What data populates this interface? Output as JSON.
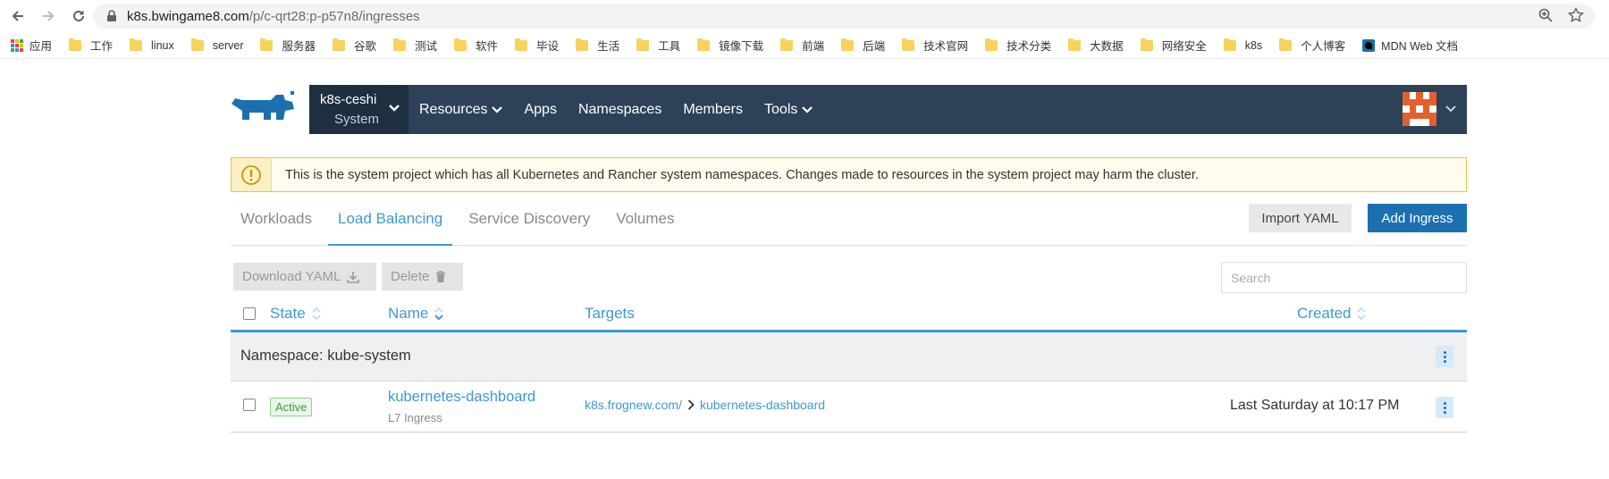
{
  "browser": {
    "url_host": "k8s.bwingame8.com",
    "url_path": "/p/c-qrt28:p-p57n8/ingresses"
  },
  "bookmarks": [
    {
      "label": "应用",
      "icon": "apps-grid-icon"
    },
    {
      "label": "工作",
      "icon": "folder-icon"
    },
    {
      "label": "linux",
      "icon": "folder-icon"
    },
    {
      "label": "server",
      "icon": "folder-icon"
    },
    {
      "label": "服务器",
      "icon": "folder-icon"
    },
    {
      "label": "谷歌",
      "icon": "folder-icon"
    },
    {
      "label": "测试",
      "icon": "folder-icon"
    },
    {
      "label": "软件",
      "icon": "folder-icon"
    },
    {
      "label": "毕设",
      "icon": "folder-icon"
    },
    {
      "label": "生活",
      "icon": "folder-icon"
    },
    {
      "label": "工具",
      "icon": "folder-icon"
    },
    {
      "label": "镜像下载",
      "icon": "folder-icon"
    },
    {
      "label": "前端",
      "icon": "folder-icon"
    },
    {
      "label": "后端",
      "icon": "folder-icon"
    },
    {
      "label": "技术官网",
      "icon": "folder-icon"
    },
    {
      "label": "技术分类",
      "icon": "folder-icon"
    },
    {
      "label": "大数据",
      "icon": "folder-icon"
    },
    {
      "label": "网络安全",
      "icon": "folder-icon"
    },
    {
      "label": "k8s",
      "icon": "folder-icon"
    },
    {
      "label": "个人博客",
      "icon": "folder-icon"
    },
    {
      "label": "MDN Web 文档",
      "icon": "mdn-icon"
    }
  ],
  "header": {
    "cluster": "k8s-ceshi",
    "project": "System",
    "nav": {
      "resources": "Resources",
      "apps": "Apps",
      "namespaces": "Namespaces",
      "members": "Members",
      "tools": "Tools"
    }
  },
  "banner": {
    "message": "This is the system project which has all Kubernetes and Rancher system namespaces. Changes made to resources in the system project may harm the cluster."
  },
  "tabs": {
    "workloads": "Workloads",
    "load_balancing": "Load Balancing",
    "service_discovery": "Service Discovery",
    "volumes": "Volumes",
    "active": "Load Balancing"
  },
  "actions": {
    "import_yaml": "Import YAML",
    "add_ingress": "Add Ingress",
    "download_yaml": "Download YAML",
    "delete": "Delete",
    "search_placeholder": "Search"
  },
  "table": {
    "columns": {
      "state": "State",
      "name": "Name",
      "targets": "Targets",
      "created": "Created"
    },
    "namespace_group": "Namespace: kube-system",
    "rows": [
      {
        "state": "Active",
        "name": "kubernetes-dashboard",
        "type": "L7 Ingress",
        "target_host": "k8s.frognew.com/",
        "target_service": "kubernetes-dashboard",
        "created": "Last Saturday at 10:17 PM"
      }
    ]
  },
  "colors": {
    "nav_bg": "#2d4258",
    "accent": "#3d98d3",
    "primary_button": "#1d70b0",
    "warning_border": "#f0c430"
  }
}
